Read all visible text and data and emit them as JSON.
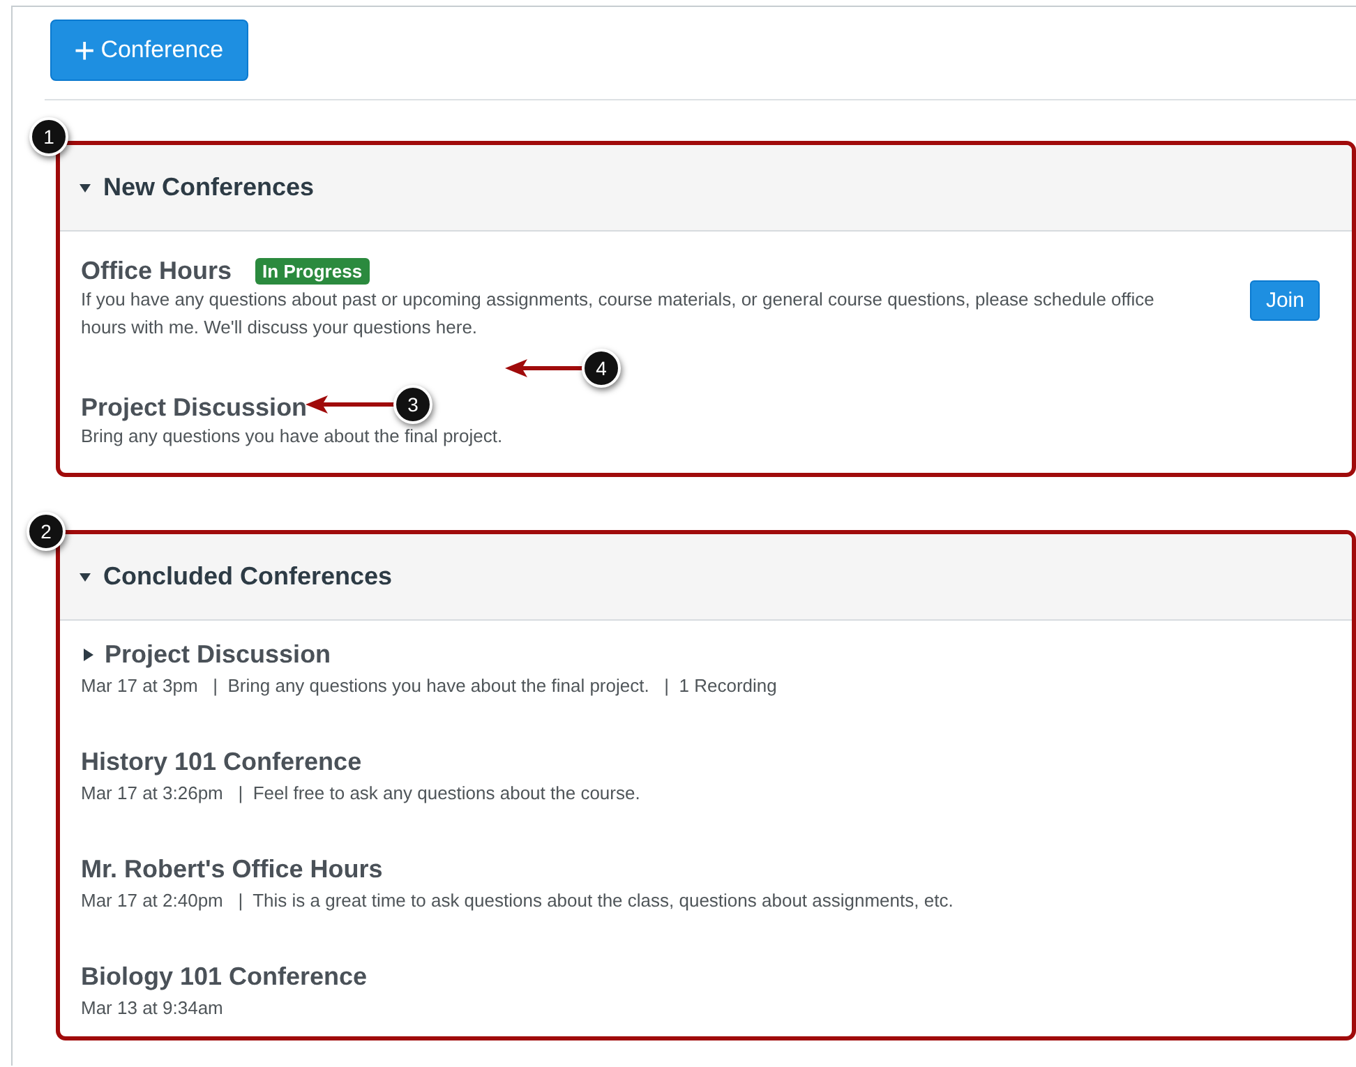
{
  "toolbar": {
    "add_button": {
      "icon": "+",
      "label": "Conference"
    }
  },
  "new_conferences": {
    "title": "New Conferences",
    "expanded": true,
    "items": [
      {
        "title": "Office Hours",
        "badge": "In Progress",
        "description": "If you have any questions about past or upcoming assignments, course materials, or general course questions, please schedule office hours with me. We'll discuss your questions here.",
        "action": "Join"
      },
      {
        "title": "Project Discussion",
        "description": "Bring any questions you have about the final project."
      }
    ]
  },
  "concluded_conferences": {
    "title": "Concluded Conferences",
    "expanded": true,
    "items": [
      {
        "title": "Project Discussion",
        "kind": "expandable",
        "expanded": false,
        "meta": "Mar 17 at 3pm   |  Bring any questions you have about the final project.   |  1 Recording"
      },
      {
        "title": "History 101 Conference",
        "kind": "plain",
        "meta": "Mar 17 at 3:26pm   |  Feel free to ask any questions about the course."
      },
      {
        "title": "Mr. Robert's Office Hours",
        "kind": "plain",
        "meta": "Mar 17 at 2:40pm   |  This is a great time to ask questions about the class, questions about assignments, etc."
      },
      {
        "title": "Biology 101 Conference",
        "kind": "plain",
        "meta": "Mar 13 at 9:34am"
      }
    ]
  },
  "callouts": [
    {
      "number": "1",
      "kind": "marker"
    },
    {
      "number": "2",
      "kind": "marker"
    },
    {
      "number": "3",
      "kind": "arrow"
    },
    {
      "number": "4",
      "kind": "arrow"
    }
  ]
}
